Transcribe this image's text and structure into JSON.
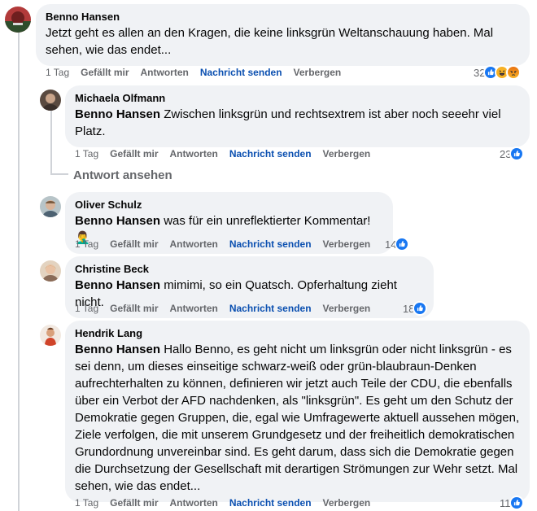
{
  "comments": [
    {
      "author": "Benno Hansen",
      "mention": "",
      "text": "Jetzt geht es allen an den Kragen, die keine linksgrün Weltanschauung haben. Mal sehen, wie das endet...",
      "time": "1 Tag",
      "reactions_count": "32",
      "reaction_icons": [
        "like-icon",
        "haha-icon",
        "angry-icon"
      ]
    },
    {
      "author": "Michaela Olfmann",
      "mention": "Benno Hansen",
      "text": "Zwischen linksgrün und rechtsextrem ist aber noch seeehr viel Platz.",
      "time": "1 Tag",
      "reactions_count": "23",
      "reaction_icons": [
        "like-icon"
      ]
    },
    {
      "author": "Oliver Schulz",
      "mention": "Benno Hansen",
      "text": "was für ein unreflektierter Kommentar! 🤦‍♂️",
      "time": "1 Tag",
      "reactions_count": "14",
      "reaction_icons": [
        "like-icon"
      ]
    },
    {
      "author": "Christine Beck",
      "mention": "Benno Hansen",
      "text": "mimimi, so ein Quatsch. Opferhaltung zieht nicht.",
      "time": "1 Tag",
      "reactions_count": "18",
      "reaction_icons": [
        "like-icon"
      ]
    },
    {
      "author": "Hendrik Lang",
      "mention": "Benno Hansen",
      "text": "Hallo Benno, es geht nicht um linksgrün oder nicht linksgrün - es sei denn, um dieses einseitige schwarz-weiß oder grün-blaubraun-Denken aufrechterhalten zu können, definieren wir jetzt auch Teile der CDU, die ebenfalls über ein Verbot der AFD nachdenken, als \"linksgrün\". Es geht um den Schutz der Demokratie gegen Gruppen, die, egal wie Umfragewerte aktuell aussehen mögen, Ziele verfolgen, die mit unserem Grundgesetz und der freiheitlich demokratischen Grundordnung unvereinbar sind. Es geht darum, dass sich die Demokratie gegen die Durchsetzung der Gesellschaft mit derartigen Strömungen zur Wehr setzt. Mal sehen, wie das endet...",
      "time": "1 Tag",
      "reactions_count": "11",
      "reaction_icons": [
        "like-icon"
      ]
    }
  ],
  "actions": {
    "like": "Gefällt mir",
    "reply": "Antworten",
    "message": "Nachricht senden",
    "hide": "Verbergen"
  },
  "view_replies": "Antwort ansehen",
  "colors": {
    "bubble_bg": "#f0f2f5",
    "muted": "#65676b",
    "link": "#0a4fb0",
    "like_blue": "#1877f2",
    "thread_line": "#d0d3d8"
  }
}
